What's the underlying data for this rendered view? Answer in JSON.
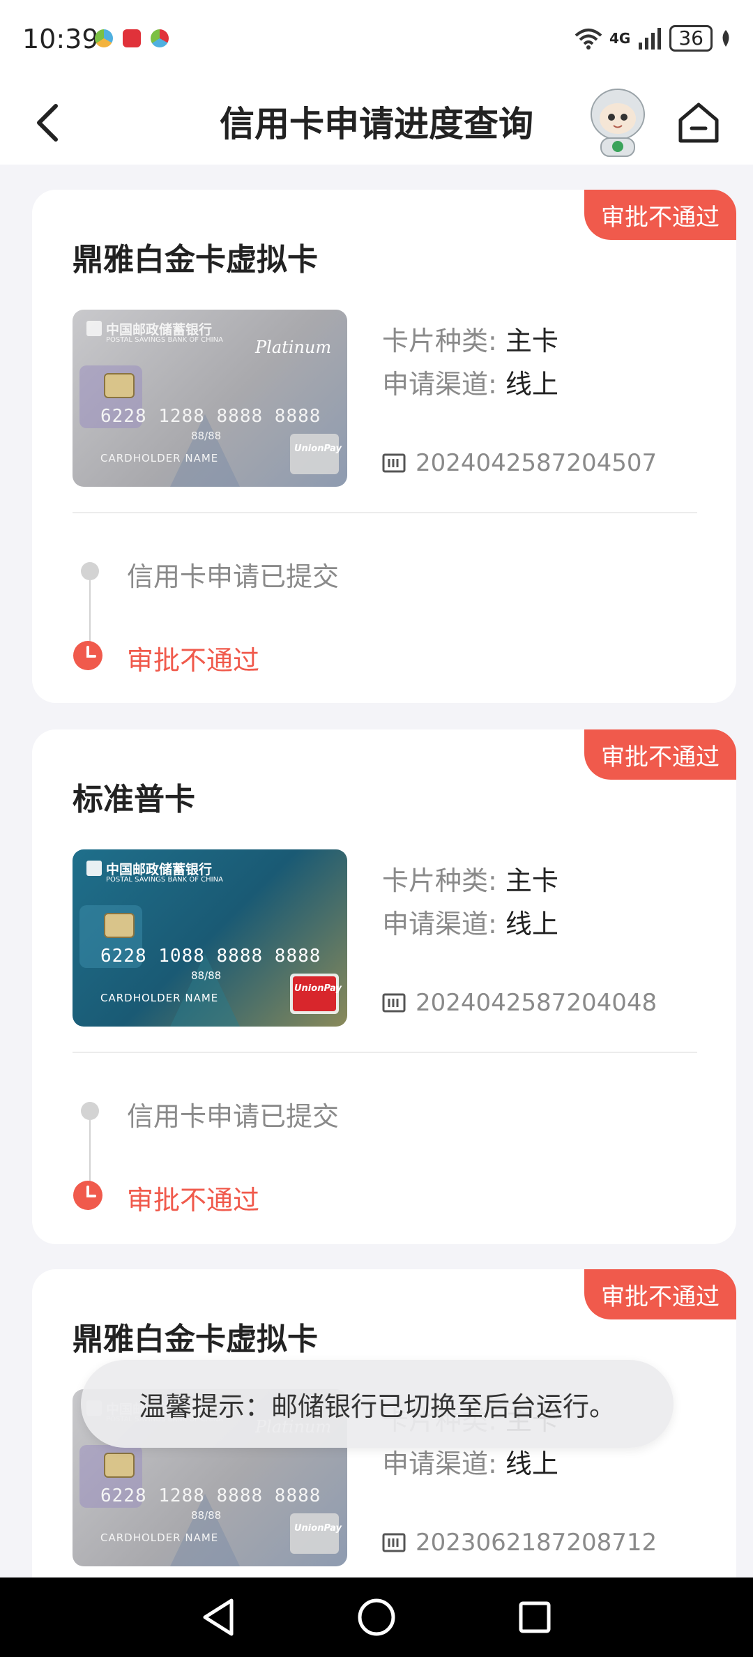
{
  "status_bar": {
    "time": "10:39",
    "network": "4G",
    "battery": "36",
    "app_colors": [
      "#4fb0e0",
      "#e0323a",
      "#7bc043"
    ]
  },
  "header": {
    "title": "信用卡申请进度查询",
    "back_icon": "chevron-left-icon",
    "home_icon": "home-icon",
    "mascot": "robot-mascot"
  },
  "applications": [
    {
      "badge": "审批不通过",
      "name": "鼎雅白金卡虚拟卡",
      "card_style": "platinum",
      "card_bank": "中国邮政储蓄银行",
      "card_bank_en": "POSTAL SAVINGS BANK OF CHINA",
      "card_subtitle": "Platinum",
      "card_number": "6228 1288 8888 8888",
      "card_valid": "88/88",
      "card_holder": "CARDHOLDER NAME",
      "card_type_label": "卡片种类:",
      "card_type_value": "主卡",
      "channel_label": "申请渠道:",
      "channel_value": "线上",
      "app_no": "2024042587204507",
      "step1": "信用卡申请已提交",
      "step2": "审批不通过"
    },
    {
      "badge": "审批不通过",
      "name": "标准普卡",
      "card_style": "standard",
      "card_bank": "中国邮政储蓄银行",
      "card_bank_en": "POSTAL SAVINGS BANK OF CHINA",
      "card_subtitle": "",
      "card_number": "6228 1088 8888 8888",
      "card_valid": "88/88",
      "card_holder": "CARDHOLDER NAME",
      "card_type_label": "卡片种类:",
      "card_type_value": "主卡",
      "channel_label": "申请渠道:",
      "channel_value": "线上",
      "app_no": "2024042587204048",
      "step1": "信用卡申请已提交",
      "step2": "审批不通过"
    },
    {
      "badge": "审批不通过",
      "name": "鼎雅白金卡虚拟卡",
      "card_style": "platinum",
      "card_bank": "中国邮政储蓄银行",
      "card_bank_en": "POSTAL SAVINGS BANK OF CHINA",
      "card_subtitle": "Platinum",
      "card_number": "6228 1288 8888 8888",
      "card_valid": "88/88",
      "card_holder": "CARDHOLDER NAME",
      "card_type_label": "卡片种类:",
      "card_type_value": "主卡",
      "channel_label": "申请渠道:",
      "channel_value": "线上",
      "app_no": "2023062187208712",
      "step1": "",
      "step2": ""
    }
  ],
  "toast": "温馨提示：邮储银行已切换至后台运行。",
  "nav": {
    "back": "back-triangle-icon",
    "home": "home-circle-icon",
    "recents": "recents-square-icon"
  }
}
